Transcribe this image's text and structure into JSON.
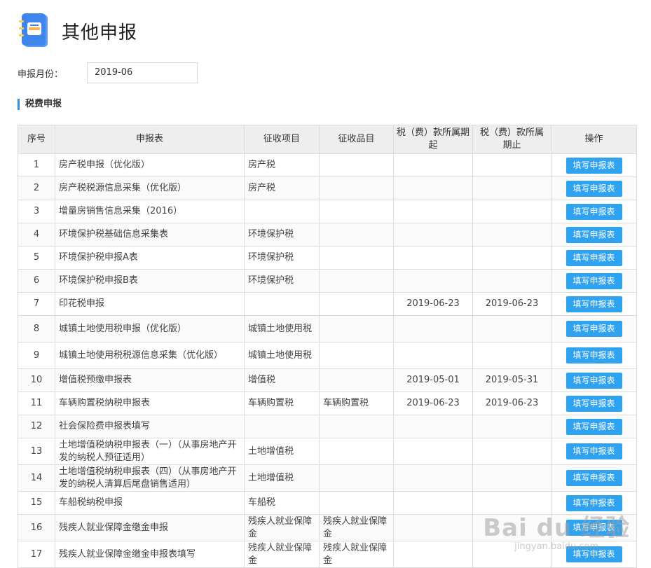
{
  "header": {
    "title": "其他申报",
    "icon": "document-icon"
  },
  "period": {
    "label": "申报月份：",
    "value": "2019-06"
  },
  "section": {
    "title": "税费申报"
  },
  "table": {
    "columns": [
      "序号",
      "申报表",
      "征收项目",
      "征收品目",
      "税（费）款所属期起",
      "税（费）款所属期止",
      "操作"
    ],
    "rows": [
      {
        "no": "1",
        "form": "房产税申报（优化版）",
        "item": "房产税",
        "sub": "",
        "start": "",
        "end": "",
        "action": "填写申报表"
      },
      {
        "no": "2",
        "form": "房产税税源信息采集（优化版）",
        "item": "房产税",
        "sub": "",
        "start": "",
        "end": "",
        "action": "填写申报表"
      },
      {
        "no": "3",
        "form": "增量房销售信息采集（2016）",
        "item": "",
        "sub": "",
        "start": "",
        "end": "",
        "action": "填写申报表"
      },
      {
        "no": "4",
        "form": "环境保护税基础信息采集表",
        "item": "环境保护税",
        "sub": "",
        "start": "",
        "end": "",
        "action": "填写申报表"
      },
      {
        "no": "5",
        "form": "环境保护税申报A表",
        "item": "环境保护税",
        "sub": "",
        "start": "",
        "end": "",
        "action": "填写申报表"
      },
      {
        "no": "6",
        "form": "环境保护税申报B表",
        "item": "环境保护税",
        "sub": "",
        "start": "",
        "end": "",
        "action": "填写申报表"
      },
      {
        "no": "7",
        "form": "印花税申报",
        "item": "",
        "sub": "",
        "start": "2019-06-23",
        "end": "2019-06-23",
        "action": "填写申报表"
      },
      {
        "no": "8",
        "form": "城镇土地使用税申报（优化版）",
        "item": "城镇土地使用税",
        "sub": "",
        "start": "",
        "end": "",
        "action": "填写申报表"
      },
      {
        "no": "9",
        "form": "城镇土地使用税税源信息采集（优化版）",
        "item": "城镇土地使用税",
        "sub": "",
        "start": "",
        "end": "",
        "action": "填写申报表"
      },
      {
        "no": "10",
        "form": "增值税预缴申报表",
        "item": "增值税",
        "sub": "",
        "start": "2019-05-01",
        "end": "2019-05-31",
        "action": "填写申报表"
      },
      {
        "no": "11",
        "form": "车辆购置税纳税申报表",
        "item": "车辆购置税",
        "sub": "车辆购置税",
        "start": "2019-06-23",
        "end": "2019-06-23",
        "action": "填写申报表"
      },
      {
        "no": "12",
        "form": "社会保险费申报表填写",
        "item": "",
        "sub": "",
        "start": "",
        "end": "",
        "action": "填写申报表"
      },
      {
        "no": "13",
        "form": "土地增值税纳税申报表（一）（从事房地产开发的纳税人预征适用）",
        "item": "土地增值税",
        "sub": "",
        "start": "",
        "end": "",
        "action": "填写申报表"
      },
      {
        "no": "14",
        "form": "土地增值税纳税申报表（四）（从事房地产开发的纳税人清算后尾盘销售适用）",
        "item": "土地增值税",
        "sub": "",
        "start": "",
        "end": "",
        "action": "填写申报表"
      },
      {
        "no": "15",
        "form": "车船税纳税申报",
        "item": "车船税",
        "sub": "",
        "start": "",
        "end": "",
        "action": "填写申报表"
      },
      {
        "no": "16",
        "form": "残疾人就业保障金缴金申报",
        "item": "残疾人就业保障金",
        "sub": "残疾人就业保障金",
        "start": "",
        "end": "",
        "action": "填写申报表"
      },
      {
        "no": "17",
        "form": "残疾人就业保障金缴金申报表填写",
        "item": "残疾人就业保障金",
        "sub": "残疾人就业保障金",
        "start": "",
        "end": "",
        "action": "填写申报表"
      }
    ]
  },
  "watermark": {
    "logo": "Bai du 经验",
    "sub": "jingyan.baidu.com"
  },
  "colors": {
    "accent": "#2fa3f0",
    "section_bar": "#2f8de4",
    "header_bg": "#eeeeee"
  }
}
